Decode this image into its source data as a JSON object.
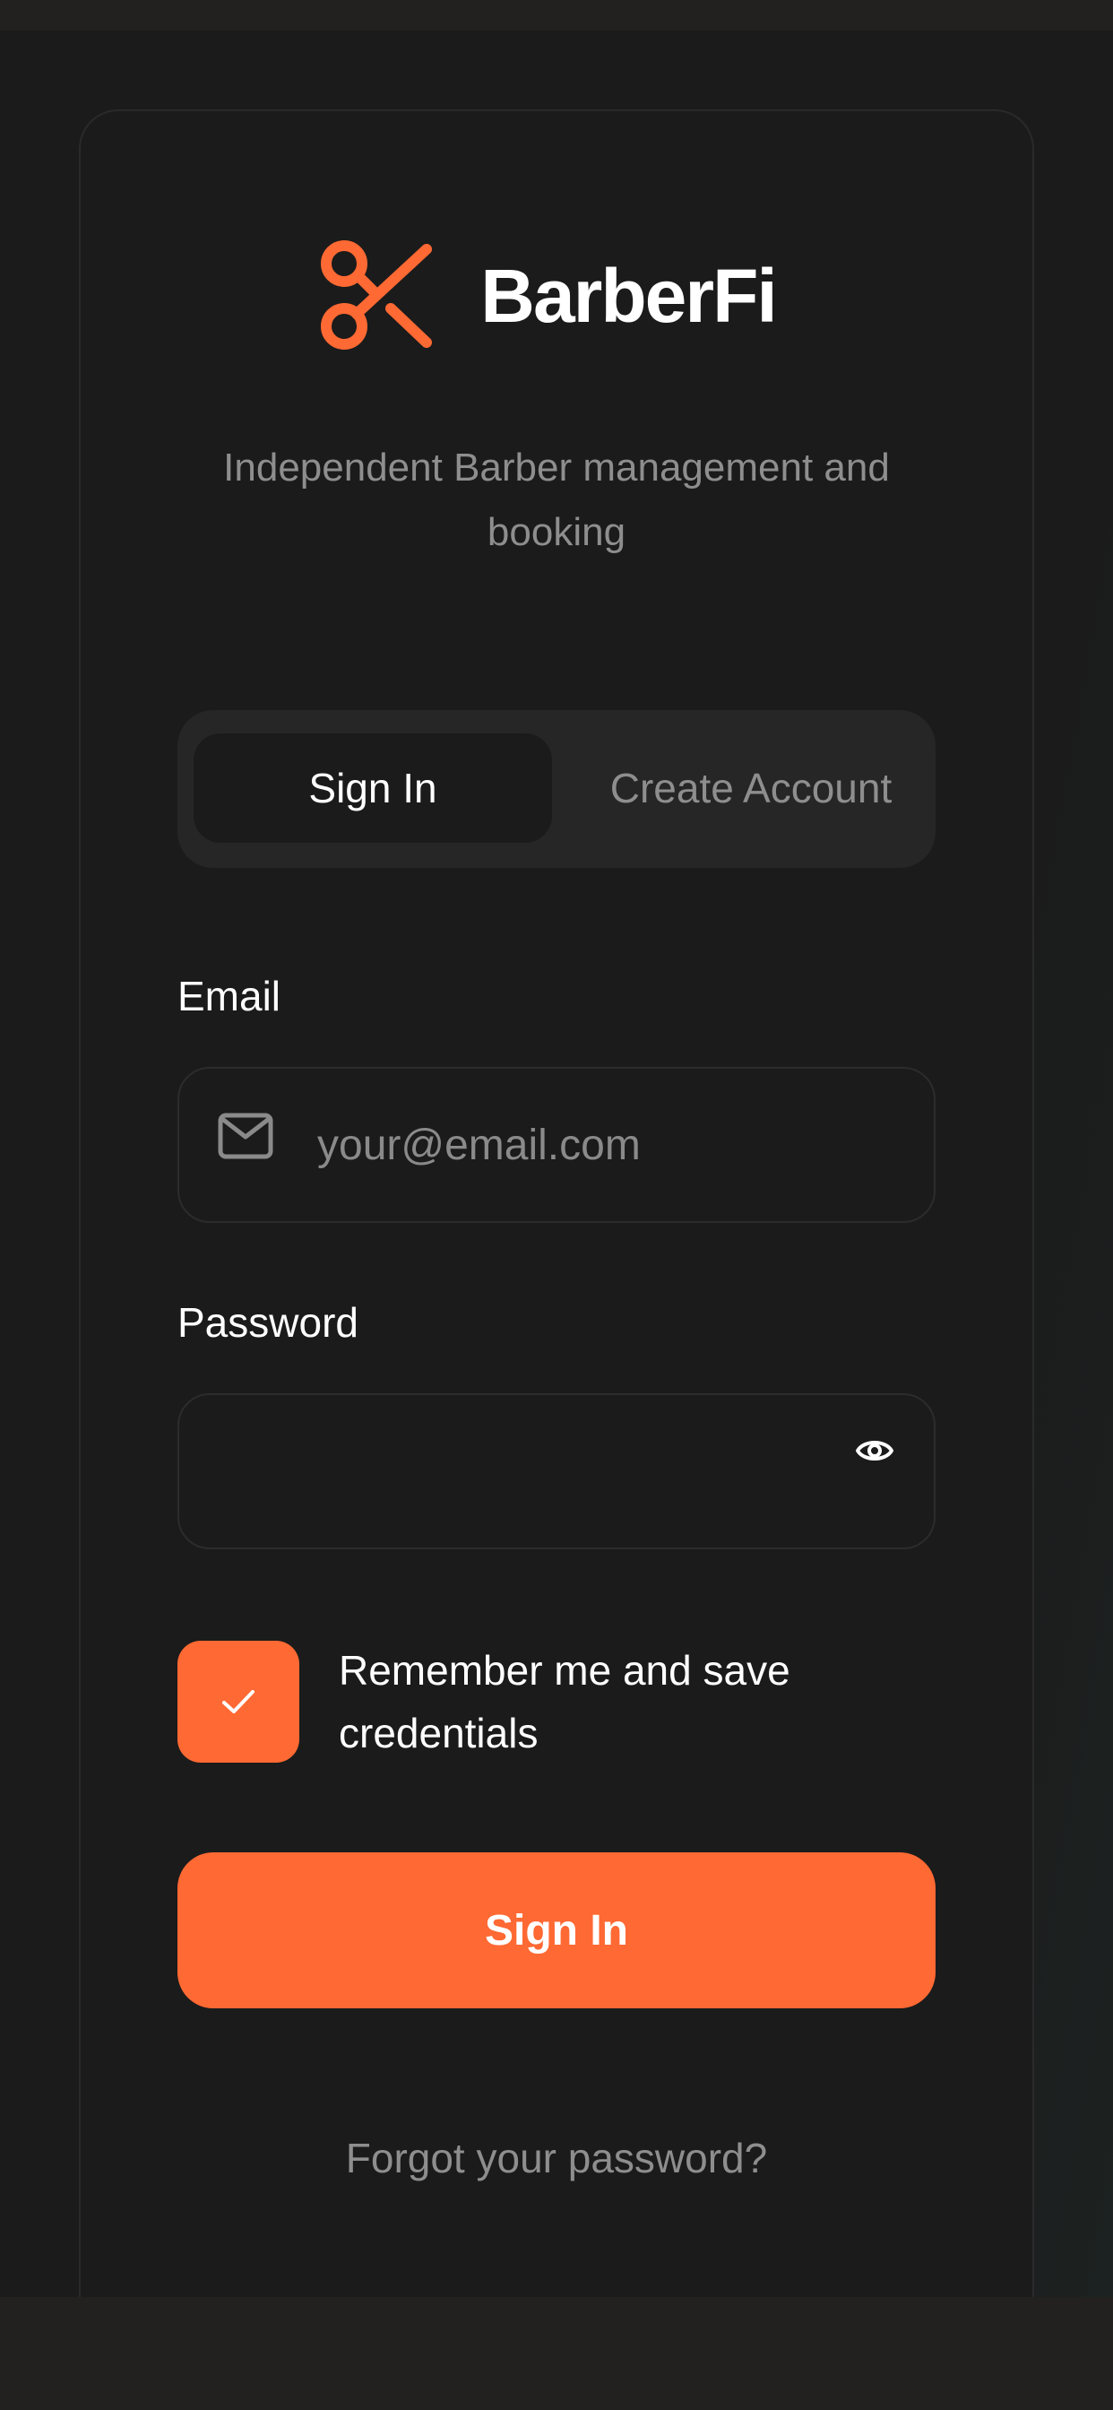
{
  "brand": {
    "name": "BarberFi",
    "tagline": "Independent Barber management and booking",
    "icon": "scissors-icon",
    "accent_color": "#ff6933"
  },
  "tabs": [
    {
      "label": "Sign In",
      "active": true
    },
    {
      "label": "Create Account",
      "active": false
    }
  ],
  "form": {
    "email_label": "Email",
    "email_placeholder": "your@email.com",
    "email_value": "",
    "password_label": "Password",
    "password_value": "",
    "remember_label": "Remember me and save credentials",
    "remember_checked": true,
    "submit_label": "Sign In",
    "forgot_label": "Forgot your password?"
  }
}
